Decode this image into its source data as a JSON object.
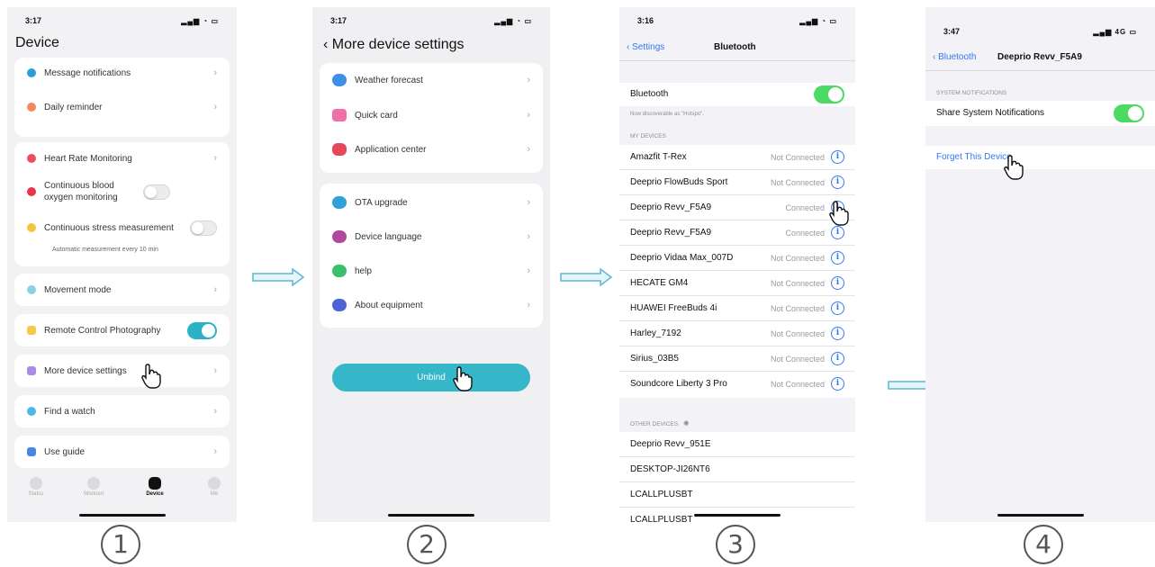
{
  "screen1": {
    "time": "3:17",
    "title": "Device",
    "groups": [
      [
        {
          "label": "Message notifications",
          "color": "#2a9fd6"
        },
        {
          "label": "Daily reminder",
          "color": "#f28a5c"
        }
      ],
      [
        {
          "label": "Heart Rate Monitoring",
          "color": "#ee4d5f"
        },
        {
          "label": "Continuous blood oxygen monitoring",
          "color": "#e8364c"
        },
        {
          "label": "Continuous stress measurement",
          "color": "#f5c540"
        }
      ]
    ],
    "stress_note": "Automatic measurement every 10 min",
    "movement_mode": "Movement mode",
    "remote_photo": "Remote Control Photography",
    "more_settings": "More device settings",
    "find_watch": "Find a watch",
    "use_guide": "Use guide",
    "tabs": [
      "Status",
      "Workout",
      "Device",
      "Me"
    ]
  },
  "screen2": {
    "time": "3:17",
    "title": "More device settings",
    "group1": [
      "Weather forecast",
      "Quick card",
      "Application center"
    ],
    "group2": [
      "OTA upgrade",
      "Device language",
      "help",
      "About equipment"
    ],
    "unbind": "Unbind"
  },
  "screen3": {
    "time": "3:16",
    "back": "Settings",
    "title": "Bluetooth",
    "bt_label": "Bluetooth",
    "discoverable": "Now discoverable as \"Hotspo\".",
    "my_devices_header": "MY DEVICES",
    "my_devices": [
      {
        "name": "Amazfit T-Rex",
        "status": "Not Connected"
      },
      {
        "name": "Deeprio FlowBuds Sport",
        "status": "Not Connected"
      },
      {
        "name": "Deeprio Revv_F5A9",
        "status": "Connected"
      },
      {
        "name": "Deeprio Revv_F5A9",
        "status": "Connected"
      },
      {
        "name": "Deeprio Vidaa Max_007D",
        "status": "Not Connected"
      },
      {
        "name": "HECATE GM4",
        "status": "Not Connected"
      },
      {
        "name": "HUAWEI FreeBuds 4i",
        "status": "Not Connected"
      },
      {
        "name": "Harley_7192",
        "status": "Not Connected"
      },
      {
        "name": "Sirius_03B5",
        "status": "Not Connected"
      },
      {
        "name": "Soundcore Liberty 3 Pro",
        "status": "Not Connected"
      }
    ],
    "other_devices_header": "OTHER DEVICES",
    "other_devices": [
      "Deeprio Revv_951E",
      "DESKTOP-JI26NT6",
      "LCALLPLUSBT",
      "LCALLPLUSBT"
    ]
  },
  "screen4": {
    "time": "3:47",
    "signal": "4G",
    "back": "Bluetooth",
    "title": "Deeprio Revv_F5A9",
    "section": "SYSTEM NOTIFICATIONS",
    "share_label": "Share System Notifications",
    "forget": "Forget This Device"
  },
  "steps": [
    "1",
    "2",
    "3",
    "4"
  ]
}
